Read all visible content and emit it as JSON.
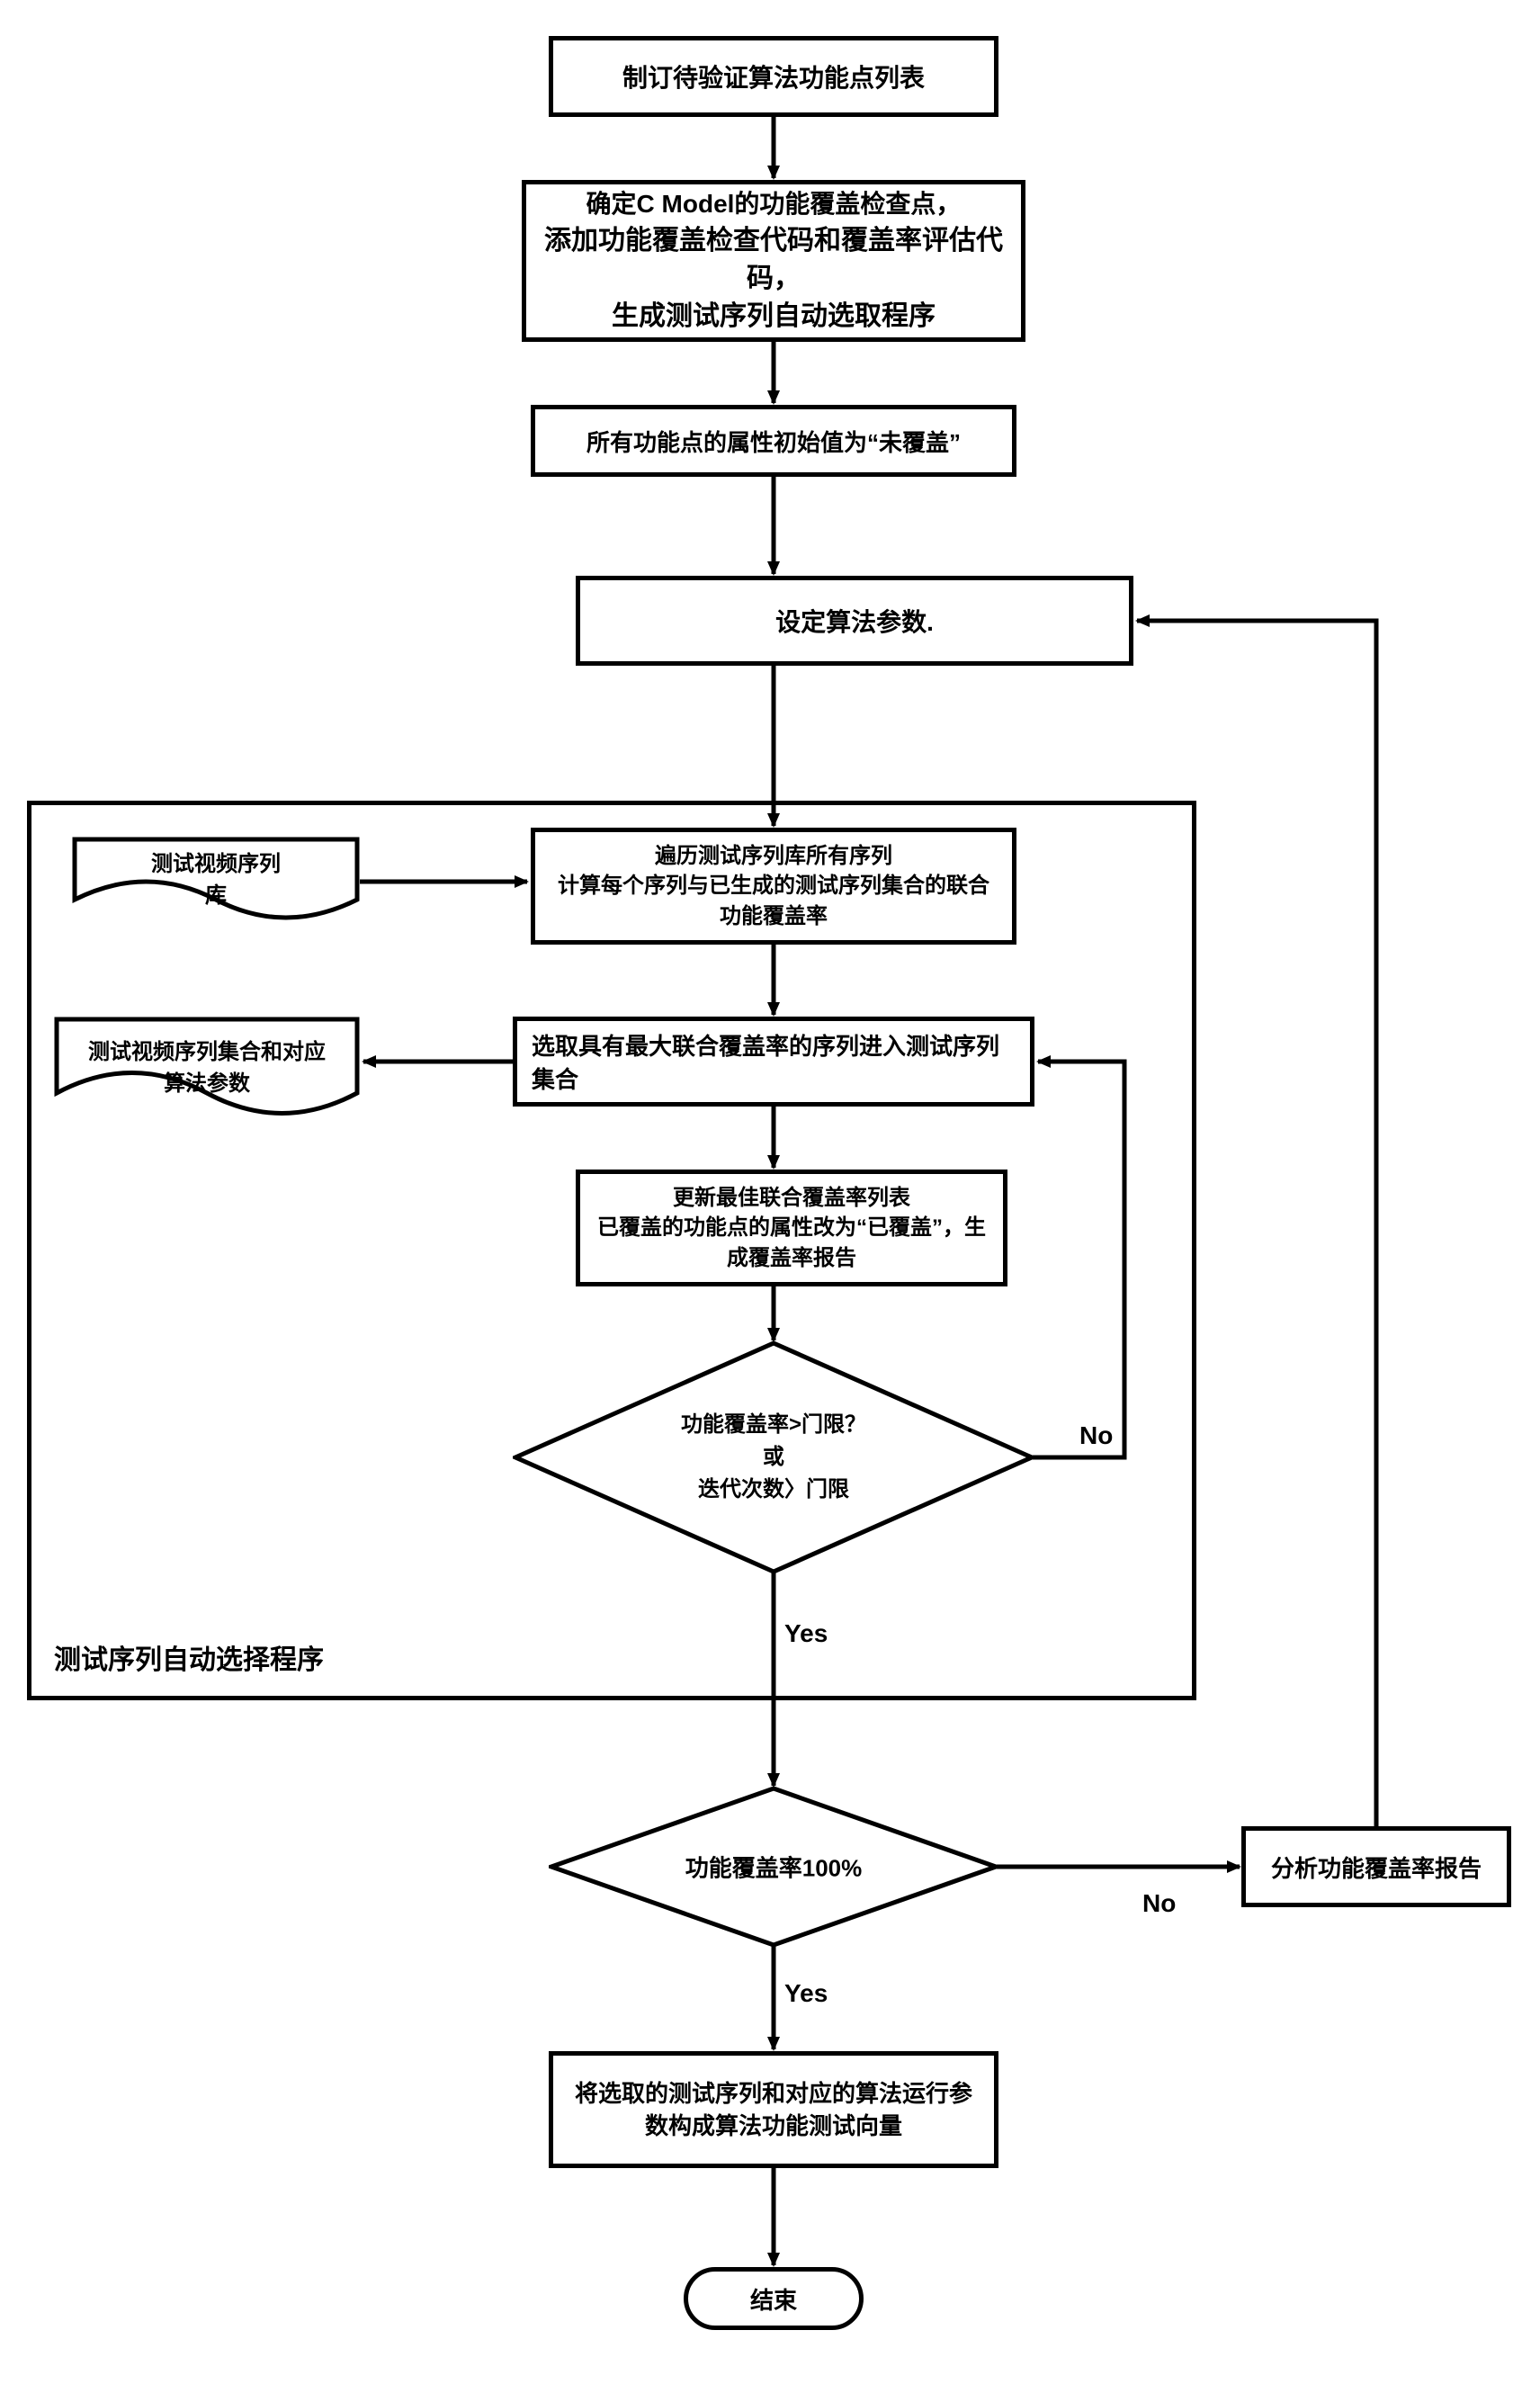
{
  "nodes": {
    "n1": "制订待验证算法功能点列表",
    "n2": "确定C Model的功能覆盖检查点，\n添加功能覆盖检查代码和覆盖率评估代码，\n生成测试序列自动选取程序",
    "n2_lines": [
      "确定C Model的功能覆盖检查点，",
      "添加功能覆盖检查代码和覆盖率评估代码，",
      "生成测试序列自动选取程序"
    ],
    "n3": "所有功能点的属性初始值为“未覆盖”",
    "n4": "设定算法参数.",
    "n5_lines": [
      "遍历测试序列库所有序列",
      "计算每个序列与已生成的测试序列集合的联合功能覆盖率"
    ],
    "n6": "选取具有最大联合覆盖率的序列进入测试序列集合",
    "n7_lines": [
      "更新最佳联合覆盖率列表",
      "已覆盖的功能点的属性改为“已覆盖”，生成覆盖率报告"
    ],
    "n8_lines": [
      "功能覆盖率>门限？",
      "或",
      "迭代次数〉门限"
    ],
    "n9": "功能覆盖率100%",
    "n10": "分析功能覆盖率报告",
    "n11": "将选取的测试序列和对应的算法运行参数构成算法功能测试向量",
    "n12": "结束",
    "doc1": "测试视频序列库",
    "doc2": "测试视频序列集合和对应算法参数",
    "container_label": "测试序列自动选择程序",
    "edge_labels": {
      "d1_no": "No",
      "d1_yes": "Yes",
      "d2_no": "No",
      "d2_yes": "Yes"
    }
  },
  "chart_data": {
    "type": "flowchart",
    "nodes": [
      {
        "id": "n1",
        "shape": "rect",
        "text": "制订待验证算法功能点列表"
      },
      {
        "id": "n2",
        "shape": "rect",
        "text": "确定C Model的功能覆盖检查点，添加功能覆盖检查代码和覆盖率评估代码，生成测试序列自动选取程序"
      },
      {
        "id": "n3",
        "shape": "rect",
        "text": "所有功能点的属性初始值为“未覆盖”"
      },
      {
        "id": "n4",
        "shape": "rect",
        "text": "设定算法参数."
      },
      {
        "id": "n5",
        "shape": "rect",
        "text": "遍历测试序列库所有序列 计算每个序列与已生成的测试序列集合的联合功能覆盖率"
      },
      {
        "id": "n6",
        "shape": "rect",
        "text": "选取具有最大联合覆盖率的序列进入测试序列集合"
      },
      {
        "id": "n7",
        "shape": "rect",
        "text": "更新最佳联合覆盖率列表 已覆盖的功能点的属性改为“已覆盖”，生成覆盖率报告"
      },
      {
        "id": "d1",
        "shape": "diamond",
        "text": "功能覆盖率>门限？ 或 迭代次数〉门限"
      },
      {
        "id": "d2",
        "shape": "diamond",
        "text": "功能覆盖率100%"
      },
      {
        "id": "n10",
        "shape": "rect",
        "text": "分析功能覆盖率报告"
      },
      {
        "id": "n11",
        "shape": "rect",
        "text": "将选取的测试序列和对应的算法运行参数构成算法功能测试向量"
      },
      {
        "id": "end",
        "shape": "terminator",
        "text": "结束"
      },
      {
        "id": "doc1",
        "shape": "document",
        "text": "测试视频序列库"
      },
      {
        "id": "doc2",
        "shape": "document",
        "text": "测试视频序列集合和对应算法参数"
      }
    ],
    "edges": [
      {
        "from": "n1",
        "to": "n2"
      },
      {
        "from": "n2",
        "to": "n3"
      },
      {
        "from": "n3",
        "to": "n4"
      },
      {
        "from": "n4",
        "to": "n5"
      },
      {
        "from": "doc1",
        "to": "n5"
      },
      {
        "from": "n5",
        "to": "n6"
      },
      {
        "from": "n6",
        "to": "doc2"
      },
      {
        "from": "n6",
        "to": "n7"
      },
      {
        "from": "n7",
        "to": "d1"
      },
      {
        "from": "d1",
        "to": "n6",
        "label": "No"
      },
      {
        "from": "d1",
        "to": "d2",
        "label": "Yes"
      },
      {
        "from": "d2",
        "to": "n10",
        "label": "No"
      },
      {
        "from": "n10",
        "to": "n4"
      },
      {
        "from": "d2",
        "to": "n11",
        "label": "Yes"
      },
      {
        "from": "n11",
        "to": "end"
      }
    ],
    "container": {
      "label": "测试序列自动选择程序",
      "contains": [
        "n5",
        "n6",
        "n7",
        "d1",
        "doc1",
        "doc2"
      ]
    }
  }
}
